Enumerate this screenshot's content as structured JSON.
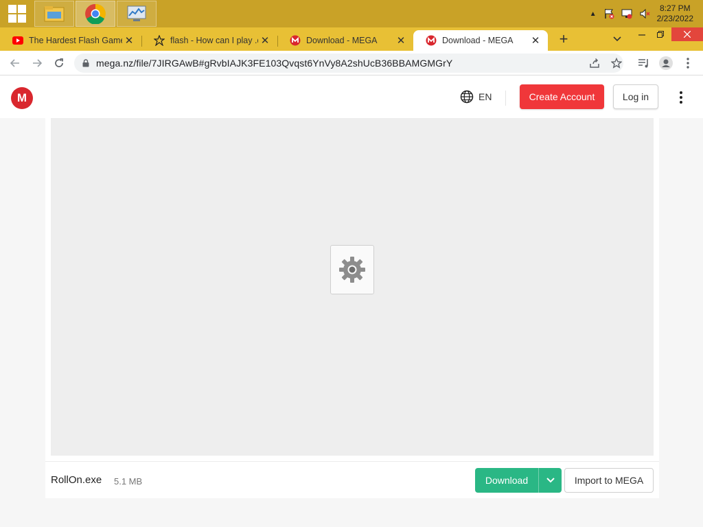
{
  "taskbar": {
    "apps": [
      "File Explorer",
      "Google Chrome",
      "Performance Monitor"
    ],
    "clock_time": "8:27 PM",
    "clock_date": "2/23/2022"
  },
  "browser": {
    "tabs": [
      {
        "title": "The Hardest Flash Game",
        "icon": "youtube-icon"
      },
      {
        "title": "flash - How can I play .dc",
        "icon": "site-icon"
      },
      {
        "title": "Download - MEGA",
        "icon": "mega-icon"
      },
      {
        "title": "Download - MEGA",
        "icon": "mega-icon",
        "active": true
      }
    ],
    "url": "mega.nz/file/7JIRGAwB#gRvbIAJK3FE103Qvqst6YnVy8A2shUcB36BBAMGMGrY"
  },
  "mega": {
    "logo_letter": "M",
    "language": "EN",
    "create_account": "Create Account",
    "login": "Log in",
    "brand_color": "#d9272e"
  },
  "file": {
    "name": "RollOn.exe",
    "size": "5.1 MB",
    "download_label": "Download",
    "import_label": "Import to MEGA"
  }
}
